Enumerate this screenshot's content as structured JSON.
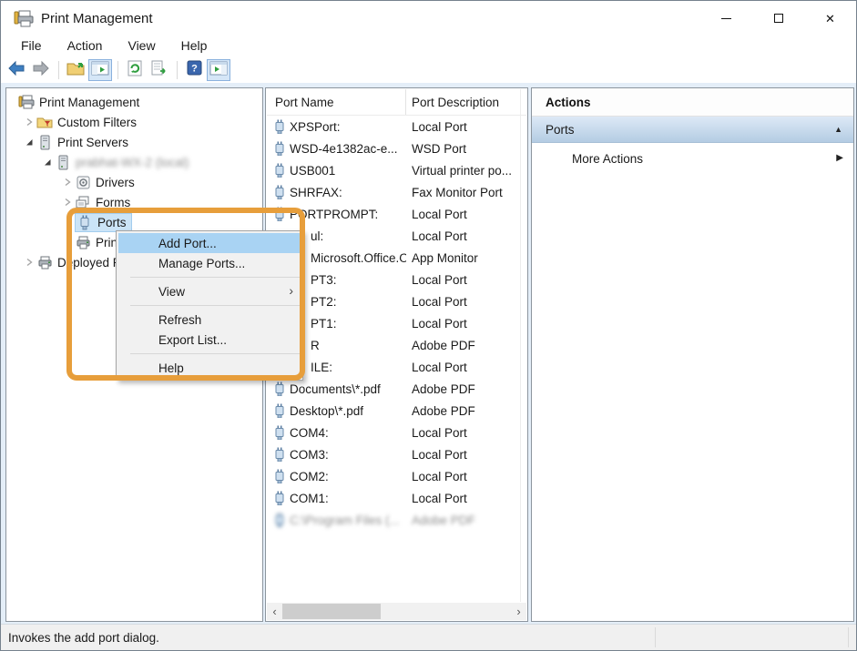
{
  "window": {
    "title": "Print Management"
  },
  "menubar": {
    "items": [
      "File",
      "Action",
      "View",
      "Help"
    ]
  },
  "toolbar": {
    "buttons": [
      {
        "icon": "back-icon"
      },
      {
        "icon": "forward-icon"
      },
      {
        "sep": true
      },
      {
        "icon": "up-one-level-icon"
      },
      {
        "icon": "show-console-tree-icon",
        "toggled": true
      },
      {
        "sep": true
      },
      {
        "icon": "refresh-icon"
      },
      {
        "icon": "export-list-icon"
      },
      {
        "sep": true
      },
      {
        "icon": "help-icon"
      },
      {
        "icon": "show-action-pane-icon",
        "toggled": true
      }
    ]
  },
  "tree": {
    "items": [
      {
        "label": "Print Management",
        "icon": "print-management-icon",
        "level": 0,
        "expander": "none"
      },
      {
        "label": "Custom Filters",
        "icon": "custom-filters-folder-icon",
        "level": 1,
        "expander": "collapsed"
      },
      {
        "label": "Print Servers",
        "icon": "server-icon",
        "level": 1,
        "expander": "expanded"
      },
      {
        "label": "prabhat-WX-2 (local)",
        "icon": "server-icon",
        "level": 2,
        "expander": "expanded",
        "blurred": true
      },
      {
        "label": "Drivers",
        "icon": "drivers-icon",
        "level": 3,
        "expander": "collapsed"
      },
      {
        "label": "Forms",
        "icon": "forms-icon",
        "level": 3,
        "expander": "collapsed"
      },
      {
        "label": "Ports",
        "icon": "port-icon",
        "level": 3,
        "expander": "none",
        "selected": true
      },
      {
        "label": "Printers",
        "icon": "printer-icon",
        "level": 3,
        "expander": "none"
      },
      {
        "label": "Deployed Printers",
        "icon": "printer-icon",
        "level": 1,
        "expander": "collapsed"
      }
    ]
  },
  "ports_list": {
    "columns": [
      "Port Name",
      "Port Description"
    ],
    "rows": [
      {
        "name": "XPSPort:",
        "desc": "Local Port"
      },
      {
        "name": "WSD-4e1382ac-e...",
        "desc": "WSD Port"
      },
      {
        "name": "USB001",
        "desc": "Virtual printer po..."
      },
      {
        "name": "SHRFAX:",
        "desc": "Fax Monitor Port"
      },
      {
        "name": "PORTPROMPT:",
        "desc": "Local Port"
      },
      {
        "name": "ul:",
        "desc": "Local Port",
        "clipped": true
      },
      {
        "name": "Microsoft.Office.O...",
        "desc": "App Monitor",
        "clipped": true
      },
      {
        "name": "PT3:",
        "desc": "Local Port",
        "clipped": true
      },
      {
        "name": "PT2:",
        "desc": "Local Port",
        "clipped": true
      },
      {
        "name": "PT1:",
        "desc": "Local Port",
        "clipped": true
      },
      {
        "name": "R",
        "desc": "Adobe PDF",
        "clipped": true
      },
      {
        "name": "ILE:",
        "desc": "Local Port",
        "clipped": true
      },
      {
        "name": "Documents\\*.pdf",
        "desc": "Adobe PDF"
      },
      {
        "name": "Desktop\\*.pdf",
        "desc": "Adobe PDF"
      },
      {
        "name": "COM4:",
        "desc": "Local Port"
      },
      {
        "name": "COM3:",
        "desc": "Local Port"
      },
      {
        "name": "COM2:",
        "desc": "Local Port"
      },
      {
        "name": "COM1:",
        "desc": "Local Port"
      },
      {
        "name": "C:\\Program Files (...",
        "desc": "Adobe PDF",
        "blurred": true
      }
    ]
  },
  "context_menu": {
    "items": [
      {
        "label": "Add Port...",
        "highlighted": true
      },
      {
        "label": "Manage Ports..."
      },
      {
        "sep": true
      },
      {
        "label": "View",
        "submenu": true
      },
      {
        "sep": true
      },
      {
        "label": "Refresh"
      },
      {
        "label": "Export List..."
      },
      {
        "sep": true
      },
      {
        "label": "Help"
      }
    ]
  },
  "actions_pane": {
    "title": "Actions",
    "section_label": "Ports",
    "more_actions_label": "More Actions"
  },
  "status_bar": {
    "text": "Invokes the add port dialog."
  },
  "annotation": {
    "shape": "rounded-rectangle",
    "color": "#e79e3b"
  },
  "colors": {
    "menu_highlight": "#a9d3f3",
    "tree_selection": "#cbe4f7",
    "actions_band_top": "#dde9f6",
    "actions_band_bottom": "#b4cce3",
    "annotation_orange": "#e79e3b"
  }
}
